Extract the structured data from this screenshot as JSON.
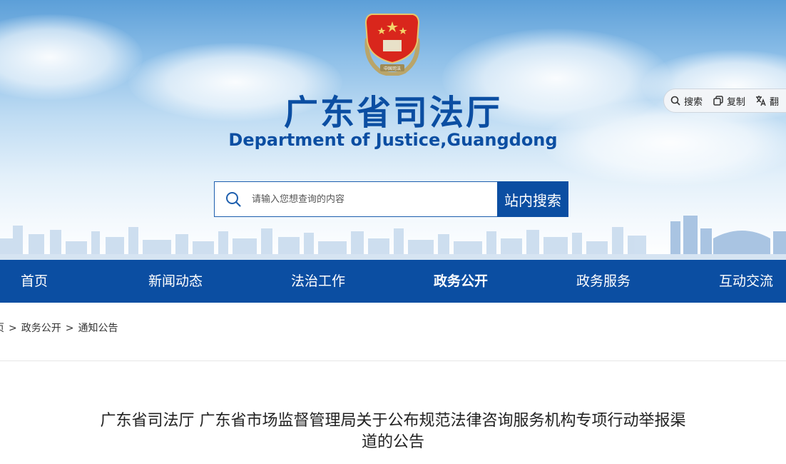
{
  "header": {
    "title": "广东省司法厅",
    "subtitle": "Department of Justice,Guangdong",
    "emblem_text": "中国司法"
  },
  "toolbar": {
    "items": [
      {
        "label": "搜索",
        "icon": "search-icon"
      },
      {
        "label": "复制",
        "icon": "copy-icon"
      },
      {
        "label": "翻",
        "icon": "translate-icon"
      }
    ]
  },
  "search": {
    "placeholder": "请输入您想查询的内容",
    "button_label": "站内搜索"
  },
  "nav": {
    "items": [
      {
        "label": "首页"
      },
      {
        "label": "新闻动态"
      },
      {
        "label": "法治工作"
      },
      {
        "label": "政务公开",
        "active": true
      },
      {
        "label": "政务服务"
      },
      {
        "label": "互动交流"
      }
    ]
  },
  "breadcrumb": {
    "items": [
      "页",
      "政务公开",
      "通知公告"
    ],
    "separator": ">"
  },
  "article": {
    "title_line1": "广东省司法厅 广东省市场监督管理局关于公布规范法律咨询服务机构专项行动举报渠",
    "title_line2": "道的公告"
  },
  "colors": {
    "brand_blue": "#0b4ea2",
    "emblem_red": "#d9261c",
    "text_dark": "#222222"
  }
}
